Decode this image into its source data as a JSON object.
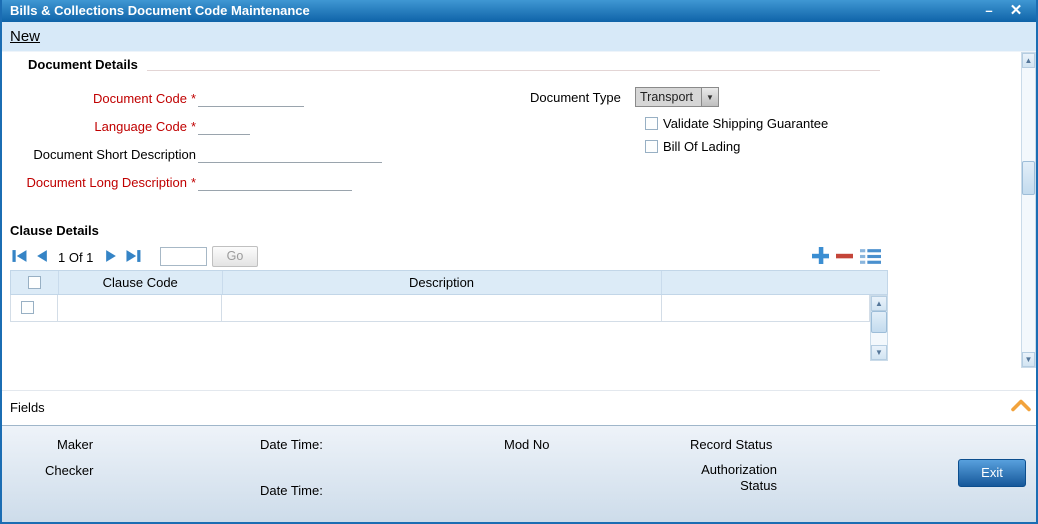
{
  "window": {
    "title": "Bills & Collections Document Code Maintenance"
  },
  "icons": {
    "minimize": "–",
    "close": "✕",
    "dropdown-arrow": "▼",
    "scroll-up": "▲",
    "scroll-down": "▼"
  },
  "toolbar": {
    "new": "New"
  },
  "document_details": {
    "title": "Document Details",
    "required_marker": "*",
    "document_code_label": "Document Code",
    "document_code_value": "",
    "language_code_label": "Language Code",
    "language_code_value": "",
    "short_desc_label": "Document Short Description",
    "short_desc_value": "",
    "long_desc_label": "Document Long Description",
    "long_desc_value": "",
    "document_type_label": "Document Type",
    "document_type_value": "Transport",
    "validate_shipping_label": "Validate Shipping Guarantee",
    "bill_of_lading_label": "Bill Of Lading"
  },
  "clause_details": {
    "title": "Clause Details",
    "pagination": {
      "position": "1 Of 1",
      "page_input": "",
      "go": "Go"
    },
    "table": {
      "columns": [
        "Clause Code",
        "Description"
      ],
      "rows": [
        {
          "clause_code": "",
          "description": ""
        }
      ]
    }
  },
  "fields_section": {
    "title": "Fields"
  },
  "footer": {
    "maker": "Maker",
    "checker": "Checker",
    "date_time_1": "Date Time:",
    "date_time_2": "Date Time:",
    "mod_no": "Mod No",
    "record_status": "Record Status",
    "authorization_status": "Authorization Status",
    "exit": "Exit"
  },
  "colors": {
    "frame": "#1b6db3",
    "titlebar-top": "#3f97d3",
    "titlebar-bottom": "#0f63a8",
    "toolbar-bg": "#d7e9f8",
    "required": "#c00000",
    "accent": "#3584c6",
    "table-header": "#dcebf7",
    "footer-top": "#eef3f9",
    "footer-bottom": "#cddcea",
    "exit-top": "#58a0dd",
    "exit-bottom": "#16589a"
  }
}
